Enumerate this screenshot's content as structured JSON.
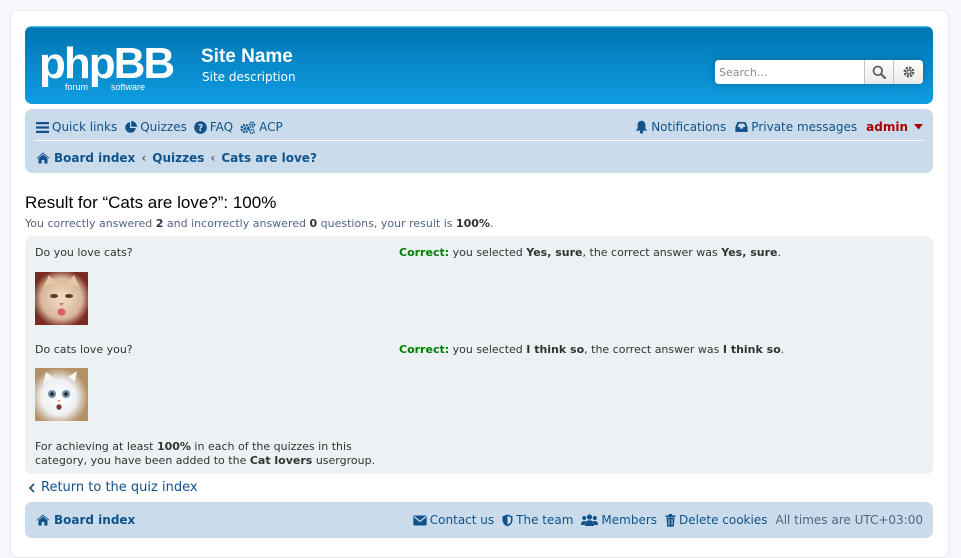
{
  "header": {
    "logo_text": "phpBB",
    "logo_sub_left": "forum",
    "logo_sub_right": "software",
    "site_name": "Site Name",
    "site_description": "Site description",
    "search_placeholder": "Search…",
    "brand_colors": {
      "header_bg": "#12a3eb",
      "nav_bg": "#cadceb",
      "link": "#105289",
      "admin": "#aa0000",
      "correct": "#008000"
    }
  },
  "nav": {
    "quick_links": "Quick links",
    "quizzes": "Quizzes",
    "faq": "FAQ",
    "acp": "ACP",
    "notifications": "Notifications",
    "private_messages": "Private messages",
    "username": "admin"
  },
  "breadcrumb": {
    "home": "Board index",
    "sep": "‹",
    "items": [
      "Quizzes",
      "Cats are love?"
    ]
  },
  "result": {
    "title": "Result for “Cats are love?”: 100%",
    "summary_1": "You correctly answered ",
    "correct_count": "2",
    "summary_2": " and incorrectly answered ",
    "incorrect_count": "0",
    "summary_3": " questions, your result is ",
    "percent": "100%",
    "summary_4": "."
  },
  "questions": [
    {
      "text": "Do you love cats?",
      "status": "Correct:",
      "selected_prefix": " you selected ",
      "selected": "Yes, sure",
      "correct_prefix": ", the correct answer was ",
      "correct": "Yes, sure",
      "end": "."
    },
    {
      "text": "Do cats love you?",
      "status": "Correct:",
      "selected_prefix": " you selected ",
      "selected": "I think so",
      "correct_prefix": ", the correct answer was ",
      "correct": "I think so",
      "end": "."
    }
  ],
  "award": {
    "part1": "For achieving at least ",
    "percent": "100%",
    "part2": " in each of the quizzes in this category, you have been added to the ",
    "group": "Cat lovers",
    "part3": " usergroup."
  },
  "back_link": "Return to the quiz index",
  "footer": {
    "home": "Board index",
    "contact": "Contact us",
    "team": "The team",
    "members": "Members",
    "delete_cookies": "Delete cookies",
    "timezone": "All times are UTC+03:00"
  }
}
